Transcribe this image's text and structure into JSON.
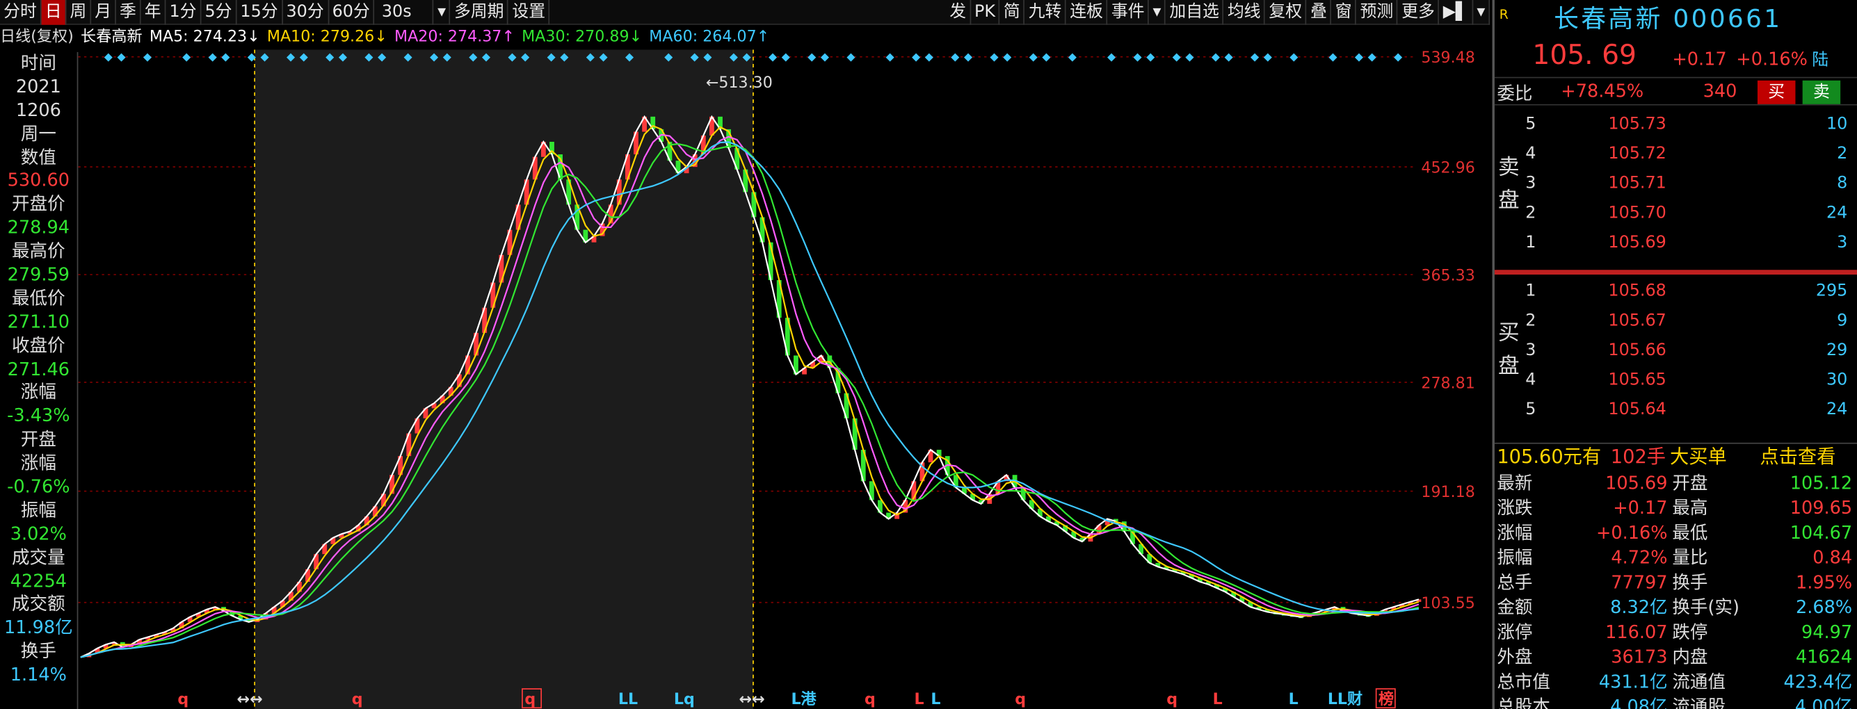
{
  "toolbar": {
    "left": [
      "分时",
      "日",
      "周",
      "月",
      "季",
      "年",
      "1分",
      "5分",
      "15分",
      "30分",
      "60分",
      "30s",
      "▾",
      "多周期",
      "设置"
    ],
    "active": "日",
    "right": [
      "发",
      "PK",
      "简",
      "九转",
      "连板",
      "事件",
      "▾",
      "加自选",
      "均线",
      "复权",
      "叠",
      "窗",
      "预测",
      "更多",
      "▶▌",
      "▾"
    ]
  },
  "chart_header": {
    "period": "日线(复权)",
    "name": "长春高新",
    "ma": [
      {
        "label": "MA5: 274.23↓",
        "color": "#ffffff"
      },
      {
        "label": "MA10: 279.26↓",
        "color": "#ffd400"
      },
      {
        "label": "MA20: 274.37↑",
        "color": "#ff5cff"
      },
      {
        "label": "MA30: 270.89↓",
        "color": "#32e632"
      },
      {
        "label": "MA60: 264.07↑",
        "color": "#3ec8ff"
      }
    ],
    "icons": "👁 ✋ ▶ ↶ ↷ ⊕ ⊖"
  },
  "left_info": [
    {
      "t": "时间",
      "c": "#ddd"
    },
    {
      "t": "2021",
      "c": "#ddd"
    },
    {
      "t": "1206",
      "c": "#ddd"
    },
    {
      "t": "周一",
      "c": "#ddd"
    },
    {
      "t": "数值",
      "c": "#ddd"
    },
    {
      "t": "530.60",
      "c": "#ff3c3c"
    },
    {
      "t": "开盘价",
      "c": "#ddd"
    },
    {
      "t": "278.94",
      "c": "#32e632"
    },
    {
      "t": "最高价",
      "c": "#ddd"
    },
    {
      "t": "279.59",
      "c": "#32e632"
    },
    {
      "t": "最低价",
      "c": "#ddd"
    },
    {
      "t": "271.10",
      "c": "#32e632"
    },
    {
      "t": "收盘价",
      "c": "#ddd"
    },
    {
      "t": "271.46",
      "c": "#32e632"
    },
    {
      "t": "涨幅",
      "c": "#ddd"
    },
    {
      "t": "-3.43%",
      "c": "#32e632"
    },
    {
      "t": "开盘",
      "c": "#ddd"
    },
    {
      "t": "涨幅",
      "c": "#ddd"
    },
    {
      "t": "-0.76%",
      "c": "#32e632"
    },
    {
      "t": "振幅",
      "c": "#ddd"
    },
    {
      "t": "3.02%",
      "c": "#32e632"
    },
    {
      "t": "成交量",
      "c": "#ddd"
    },
    {
      "t": "42254",
      "c": "#32e632"
    },
    {
      "t": "成交额",
      "c": "#ddd"
    },
    {
      "t": "11.98亿",
      "c": "#3ec8ff"
    },
    {
      "t": "换手",
      "c": "#ddd"
    },
    {
      "t": "1.14%",
      "c": "#3ec8ff"
    }
  ],
  "chart_data": {
    "type": "line",
    "ylabels": [
      "539.48",
      "452.96",
      "365.33",
      "278.81",
      "191.18",
      "103.55"
    ],
    "ylim": [
      103.55,
      539.48
    ],
    "close": [
      60,
      63,
      67,
      70,
      72,
      68,
      70,
      74,
      76,
      78,
      80,
      83,
      88,
      92,
      95,
      98,
      100,
      97,
      93,
      90,
      88,
      90,
      95,
      100,
      105,
      112,
      120,
      130,
      142,
      150,
      155,
      158,
      160,
      165,
      172,
      180,
      190,
      205,
      220,
      238,
      250,
      258,
      262,
      268,
      275,
      285,
      300,
      318,
      338,
      358,
      380,
      400,
      420,
      440,
      458,
      470,
      460,
      440,
      420,
      400,
      390,
      395,
      405,
      420,
      440,
      460,
      478,
      490,
      480,
      470,
      455,
      445,
      450,
      460,
      475,
      490,
      480,
      465,
      448,
      430,
      410,
      390,
      360,
      330,
      300,
      285,
      290,
      295,
      300,
      290,
      270,
      250,
      225,
      200,
      185,
      175,
      170,
      175,
      185,
      200,
      215,
      225,
      220,
      205,
      195,
      190,
      185,
      182,
      190,
      200,
      205,
      195,
      185,
      178,
      172,
      168,
      165,
      160,
      155,
      152,
      158,
      165,
      170,
      168,
      160,
      150,
      142,
      135,
      132,
      130,
      128,
      126,
      123,
      120,
      118,
      115,
      112,
      108,
      104,
      100,
      98,
      96,
      95,
      94,
      93,
      92,
      94,
      96,
      98,
      100,
      97,
      95,
      94,
      93,
      95,
      98,
      100,
      102,
      104,
      106
    ],
    "flags": [
      {
        "x": 150,
        "t": "q",
        "c": "#ff3c3c"
      },
      {
        "x": 200,
        "t": "↔↔",
        "c": "#ddd"
      },
      {
        "x": 297,
        "t": "q",
        "c": "#ff3c3c"
      },
      {
        "x": 443,
        "t": "q",
        "c": "#ff3c3c",
        "box": true
      },
      {
        "x": 522,
        "t": "LL",
        "c": "#3ec8ff"
      },
      {
        "x": 569,
        "t": "Lq",
        "c": "#3ec8ff"
      },
      {
        "x": 624,
        "t": "↔↔",
        "c": "#ddd"
      },
      {
        "x": 668,
        "t": "L港",
        "c": "#3ec8ff"
      },
      {
        "x": 730,
        "t": "q",
        "c": "#ff3c3c"
      },
      {
        "x": 772,
        "t": "L",
        "c": "#ff3c3c"
      },
      {
        "x": 786,
        "t": "L",
        "c": "#3ec8ff"
      },
      {
        "x": 857,
        "t": "q",
        "c": "#ff3c3c"
      },
      {
        "x": 985,
        "t": "q",
        "c": "#ff3c3c"
      },
      {
        "x": 1024,
        "t": "L",
        "c": "#ff3c3c"
      },
      {
        "x": 1088,
        "t": "L",
        "c": "#3ec8ff"
      },
      {
        "x": 1121,
        "t": "LL财",
        "c": "#3ec8ff"
      },
      {
        "x": 1164,
        "t": "榜",
        "c": "#ff3c3c",
        "box": true
      }
    ],
    "peak_label": "513.30"
  },
  "right": {
    "r": "R",
    "name": "长春高新  000661",
    "price": "105. 69",
    "change": "+0.17",
    "pct": "+0.16%",
    "lu": "陆",
    "weibi_label": "委比",
    "weibi_val": "+78.45%",
    "weibi_num": "340",
    "buy_btn": "买",
    "sell_btn": "卖",
    "sell_label": "卖盘",
    "buy_label": "买盘",
    "asks": [
      [
        "5",
        "105.73",
        "10"
      ],
      [
        "4",
        "105.72",
        "2"
      ],
      [
        "3",
        "105.71",
        "8"
      ],
      [
        "2",
        "105.70",
        "24"
      ],
      [
        "1",
        "105.69",
        "3"
      ]
    ],
    "bids": [
      [
        "1",
        "105.68",
        "295"
      ],
      [
        "2",
        "105.67",
        "9"
      ],
      [
        "3",
        "105.66",
        "29"
      ],
      [
        "4",
        "105.65",
        "30"
      ],
      [
        "5",
        "105.64",
        "24"
      ]
    ],
    "ad": {
      "a": "105.60元有",
      "b": "102手",
      "c": "大买单",
      "d": "点击查看"
    },
    "stats": [
      [
        "最新",
        "105.69",
        "开盘",
        "105.12",
        "#ff3c3c",
        "#32e632"
      ],
      [
        "涨跌",
        "+0.17",
        "最高",
        "109.65",
        "#ff3c3c",
        "#ff3c3c"
      ],
      [
        "涨幅",
        "+0.16%",
        "最低",
        "104.67",
        "#ff3c3c",
        "#32e632"
      ],
      [
        "振幅",
        "4.72%",
        "量比",
        "0.84",
        "#ff3c3c",
        "#ff3c3c"
      ],
      [
        "总手",
        "77797",
        "换手",
        "1.95%",
        "#ff3c3c",
        "#ff3c3c"
      ],
      [
        "金额",
        "8.32亿",
        "换手(实)",
        "2.68%",
        "#3ec8ff",
        "#3ec8ff"
      ],
      [
        "涨停",
        "116.07",
        "跌停",
        "94.97",
        "#ff3c3c",
        "#32e632"
      ],
      [
        "外盘",
        "36173",
        "内盘",
        "41624",
        "#ff3c3c",
        "#32e632"
      ],
      [
        "总市值",
        "431.1亿",
        "流通值",
        "423.4亿",
        "#3ec8ff",
        "#3ec8ff"
      ],
      [
        "总股本",
        "4.08亿",
        "流通股",
        "4.00亿",
        "#3ec8ff",
        "#3ec8ff"
      ]
    ]
  }
}
